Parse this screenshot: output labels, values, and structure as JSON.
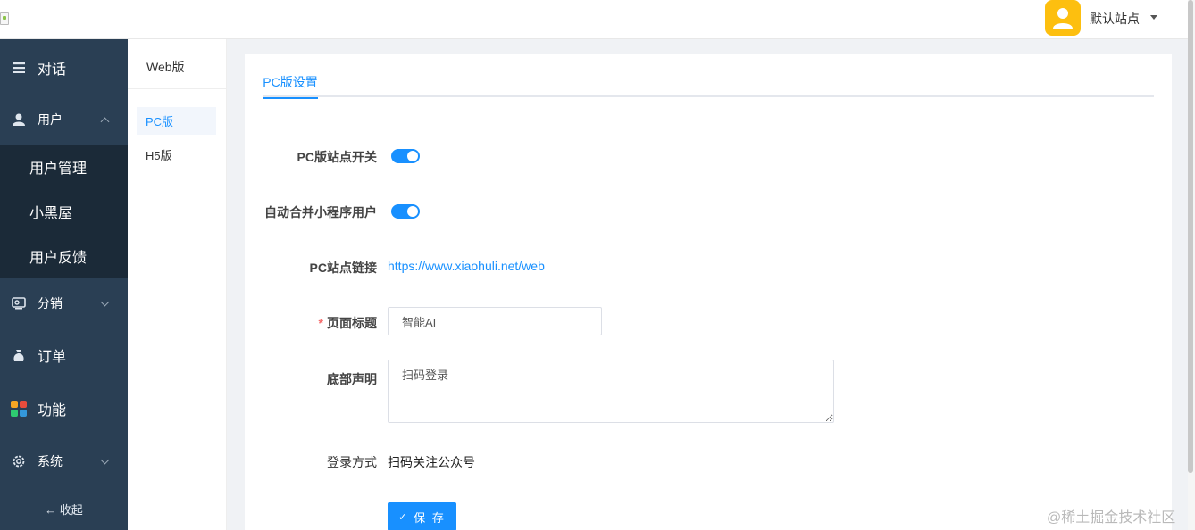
{
  "header": {
    "site_name": "默认站点",
    "avatar_color": "#fdbf0f"
  },
  "sidebar": {
    "items": [
      {
        "label": "对话",
        "icon": "menu-lines-icon"
      },
      {
        "label": "用户",
        "icon": "user-icon",
        "expanded": true
      },
      {
        "label": "分销",
        "icon": "wallet-icon"
      },
      {
        "label": "订单",
        "icon": "money-bag-icon"
      },
      {
        "label": "功能",
        "icon": "apps-grid-icon"
      },
      {
        "label": "系统",
        "icon": "gear-icon"
      }
    ],
    "sub_items": [
      "用户管理",
      "小黑屋",
      "用户反馈"
    ],
    "collapse_label": "收起",
    "bg_color": "#2a3f54"
  },
  "subnav": {
    "title": "Web版",
    "items": [
      {
        "label": "PC版",
        "active": true
      },
      {
        "label": "H5版",
        "active": false
      }
    ]
  },
  "main": {
    "tab": "PC版设置",
    "fields": {
      "pc_switch_label": "PC版站点开关",
      "pc_switch_on": true,
      "merge_label": "自动合并小程序用户",
      "merge_on": true,
      "link_label": "PC站点链接",
      "link_value": "https://www.xiaohuli.net/web",
      "title_label": "页面标题",
      "title_value": "智能AI",
      "footer_label": "底部声明",
      "footer_value": "扫码登录",
      "login_label": "登录方式",
      "login_value": "扫码关注公众号"
    },
    "save_label": "保 存",
    "accent_color": "#1890ff"
  },
  "watermark": "@稀土掘金技术社区"
}
